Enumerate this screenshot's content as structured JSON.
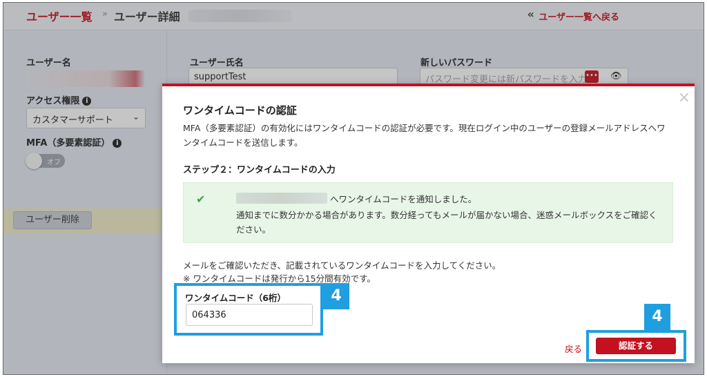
{
  "header": {
    "breadcrumb_link": "ユーザー一覧",
    "breadcrumb_sep": "»",
    "breadcrumb_current": "ユーザー詳細",
    "back_icon": "«",
    "back_link": "ユーザー一覧へ戻る"
  },
  "left": {
    "username_label": "ユーザー名",
    "access_label": "アクセス権限",
    "access_value": "カスタマーサポート",
    "mfa_label": "MFA（多要素認証）",
    "mfa_toggle_text": "オフ",
    "delete_button": "ユーザー削除"
  },
  "main": {
    "fullname_label": "ユーザー氏名",
    "fullname_value": "supportTest",
    "new_password_label": "新しいパスワード",
    "new_password_placeholder": "パスワード変更には新パスワードを入力"
  },
  "modal": {
    "title": "ワンタイムコードの認証",
    "description": "MFA（多要素認証）の有効化にはワンタイムコードの認証が必要です。現在ログイン中のユーザーの登録メールアドレスへワンタイムコードを送信します。",
    "step": "ステップ２：ワンタイムコードの入力",
    "alert_line1": "へワンタイムコードを通知しました。",
    "alert_line2": "通知までに数分かかる場合があります。数分経ってもメールが届かない場合、迷惑メールボックスをご確認ください。",
    "note_line1": "メールをご確認いただき、記載されているワンタイムコードを入力してください。",
    "note_line2": "※ ワンタイムコードは発行から15分間有効です。",
    "code_label": "ワンタイムコード（6桁）",
    "code_value": "064336",
    "back_button": "戻る",
    "verify_button": "認証する",
    "close_icon": "×"
  },
  "annotations": {
    "badge_code": "4",
    "badge_verify": "4",
    "highlight_color": "#1f9ee0"
  },
  "colors": {
    "brand_red": "#c3111f",
    "success_bg": "#e7f6e7",
    "success_check": "#2aa64a"
  }
}
